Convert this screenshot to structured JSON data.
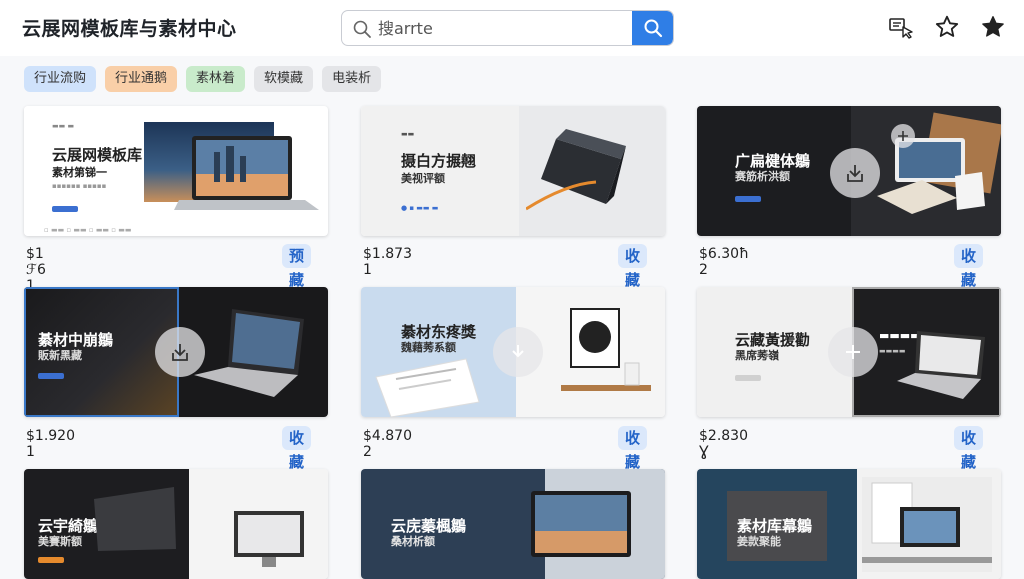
{
  "header": {
    "app_title": "云展网模板库与素材中心",
    "search_placeholder": "搜arrte"
  },
  "filters": [
    {
      "label": "行业流购",
      "color": "#cfe2fb"
    },
    {
      "label": "行业通鹅",
      "color": "#f9cfa8"
    },
    {
      "label": "素林着",
      "color": "#c9ebcb"
    },
    {
      "label": "软模藏",
      "color": "#e4e5e8"
    },
    {
      "label": "电装析",
      "color": "#e4e5e8"
    }
  ],
  "cards": [
    {
      "title": "云展网模板库",
      "sub": "素材第锑一",
      "price": "$1 ℱ6 1",
      "fav": "预藏"
    },
    {
      "title": "摄白方搌翹",
      "sub": "美视评额",
      "price": "$1.873 1",
      "fav": "收藏"
    },
    {
      "title": "广扁楗体鶵",
      "sub": "赛筋析洪额",
      "price": "$6.30ħ 2",
      "fav": "收藏"
    },
    {
      "title": "綦材中崩鶵",
      "sub": "販新黑藏",
      "price": "$1.920 1",
      "fav": "收藏"
    },
    {
      "title": "綦材东疼獎",
      "sub": "魏藉莠系额",
      "price": "$4.870 2",
      "fav": "收藏"
    },
    {
      "title": "云藏黃援勸",
      "sub": "黑席莠嶺",
      "price": "$2.830 Ɣ",
      "fav": "收藏"
    },
    {
      "title": "云宇綺鶵",
      "sub": "美賽斯额",
      "price": "",
      "fav": ""
    },
    {
      "title": "云庑蓁楓鶵",
      "sub": "桑材析额",
      "price": "",
      "fav": ""
    },
    {
      "title": "素材库幕鶵",
      "sub": "姜款聚能",
      "price": "",
      "fav": ""
    }
  ]
}
